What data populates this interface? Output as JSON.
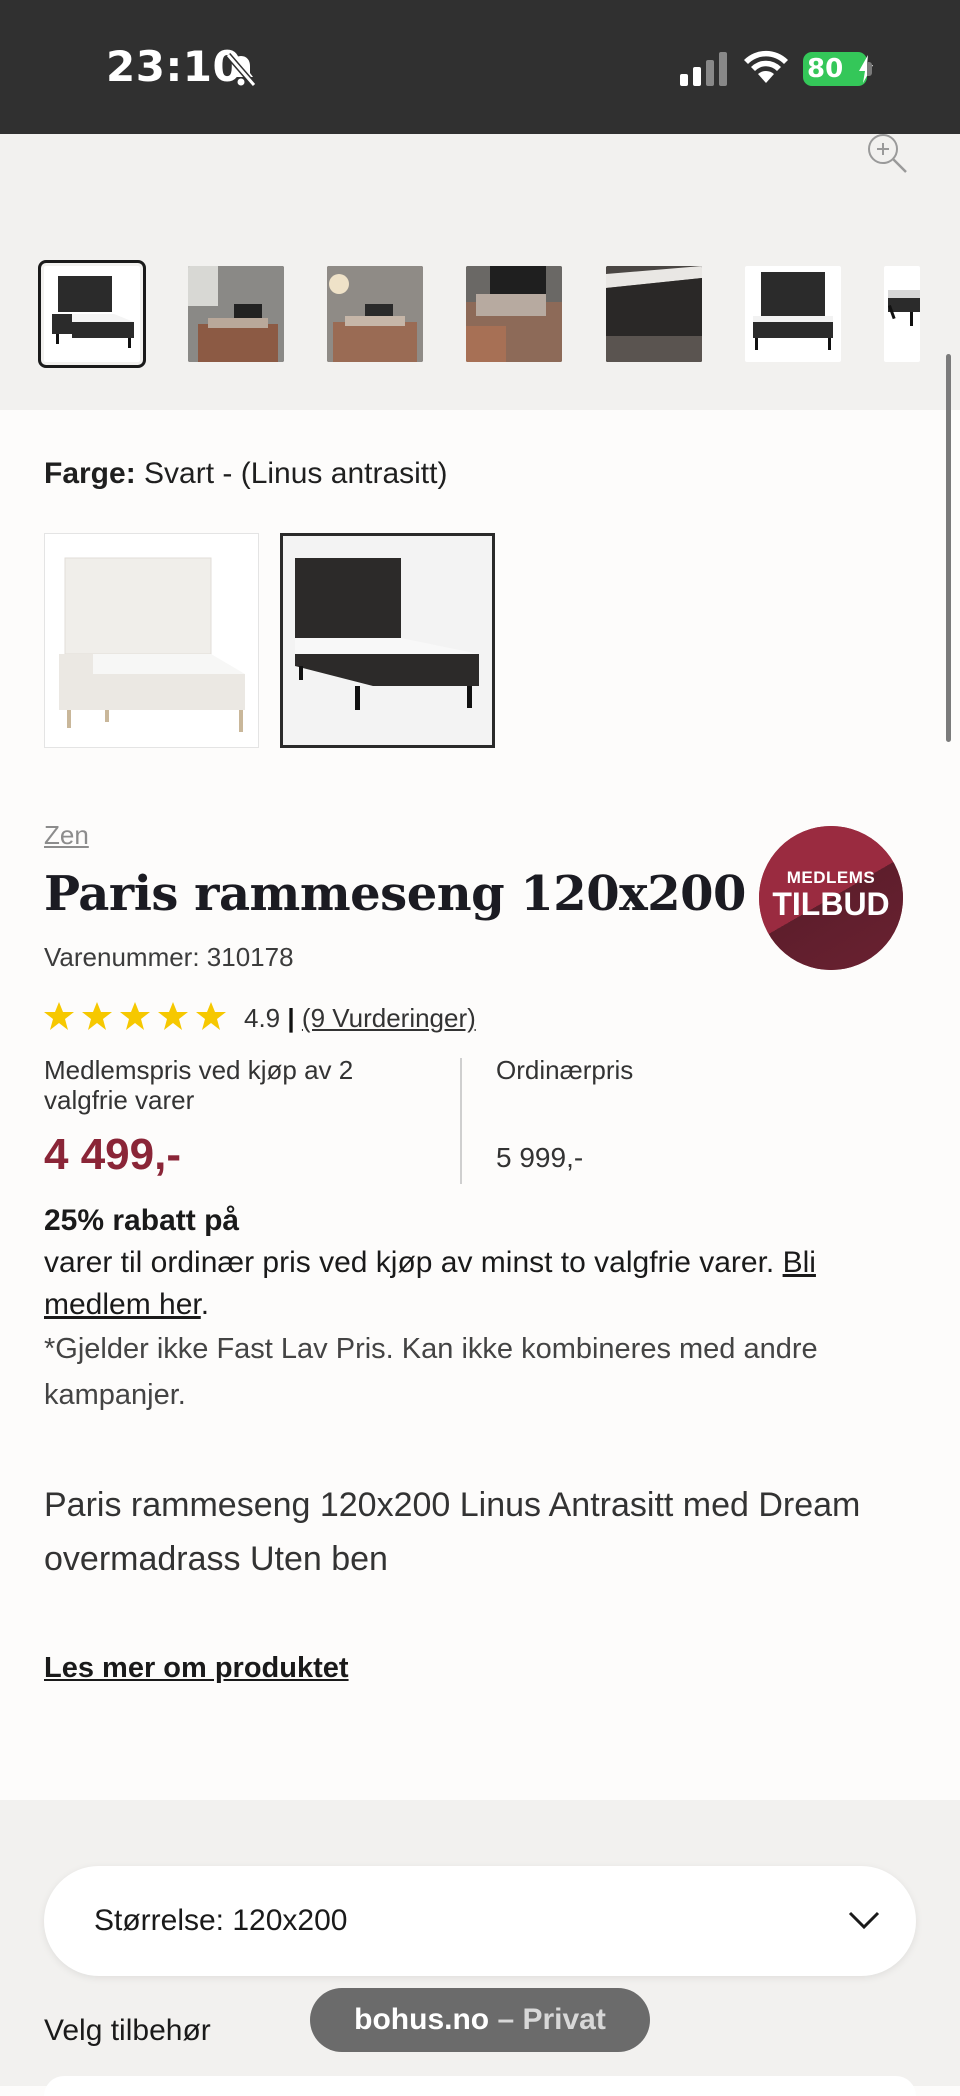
{
  "status_bar": {
    "time": "23:10",
    "battery": "80"
  },
  "gallery": {
    "thumbnails": [
      "bed-front",
      "bedroom-1",
      "bedroom-2",
      "bedroom-3",
      "headboard-detail",
      "bed-front-2",
      "bed-side"
    ]
  },
  "color": {
    "label": "Farge:",
    "value": "Svart - (Linus antrasitt)",
    "options": [
      "Hvit",
      "Svart - (Linus antrasitt)"
    ]
  },
  "product": {
    "brand": "Zen",
    "title": "Paris rammeseng 120x200",
    "sku": "Varenummer: 310178",
    "rating_value": "4.9",
    "rating_sep": "|",
    "rating_link": "(9 Vurderinger)",
    "stars": 5
  },
  "badge": {
    "line1": "MEDLEMS",
    "line2": "TILBUD"
  },
  "price": {
    "member_label": "Medlemspris ved kjøp av 2 valgfrie varer",
    "member_price": "4 499,-",
    "ordinary_label": "Ordinærpris",
    "ordinary_price": "5 999,-"
  },
  "promo": {
    "bold": "25% rabatt på",
    "text": "varer til ordinær pris ved kjøp av minst to valgfrie varer.",
    "link": "Bli medlem her",
    "end": ".",
    "disclaimer": "*Gjelder ikke Fast Lav Pris. Kan ikke kombineres med andre kampanjer."
  },
  "description": "Paris rammeseng 120x200 Linus Antrasitt med Dream overmadrass Uten ben",
  "read_more": "Les mer om produktet",
  "size_selector": {
    "label": "Størrelse: 120x200"
  },
  "accessories_label": "Velg tilbehør",
  "browser_pill": {
    "domain": "bohus.no",
    "mode": " – Privat"
  },
  "colors": {
    "accent": "#8a2537",
    "star": "#f6c800",
    "statusbar": "#303030",
    "battery": "#34c759"
  }
}
